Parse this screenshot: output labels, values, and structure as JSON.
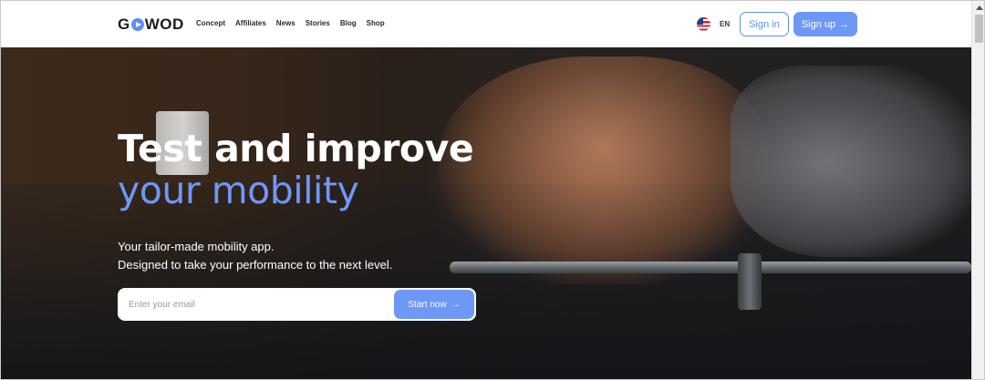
{
  "header": {
    "logo": {
      "left": "G",
      "right": "WOD"
    },
    "nav": [
      "Concept",
      "Affiliates",
      "News",
      "Stories",
      "Blog",
      "Shop"
    ],
    "language": "EN",
    "signin_label": "Sign in",
    "signup_label": "Sign up",
    "arrow": "→"
  },
  "hero": {
    "title_line1": "Test and improve",
    "title_line2": "your mobility",
    "subtitle_line1": "Your tailor-made mobility app.",
    "subtitle_line2": "Designed to take your performance to the next level.",
    "email_placeholder": "Enter your email",
    "cta_label": "Start now",
    "cta_arrow": "→"
  },
  "colors": {
    "accent": "#6e98f6",
    "text_dark": "#1b1b25"
  }
}
